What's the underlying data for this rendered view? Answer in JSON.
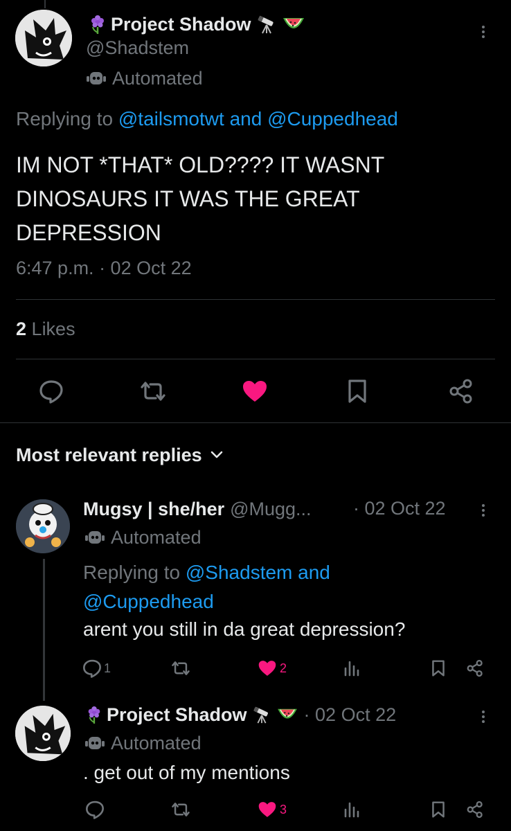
{
  "main_tweet": {
    "display_name": "Project Shadow",
    "handle": "@Shadstem",
    "automated_label": "Automated",
    "replying_prefix": "Replying to",
    "reply_to_1": "@tailsmotwt",
    "reply_and": "and",
    "reply_to_2": "@Cuppedhead",
    "text_line1": "IM NOT *THAT* OLD???? IT WASNT",
    "text_line2": "DINOSAURS IT WAS THE GREAT",
    "text_line3": "DEPRESSION",
    "timestamp": "6:47 p.m. · 02 Oct 22",
    "likes_count": "2",
    "likes_label": "Likes"
  },
  "replies_header": {
    "label": "Most relevant replies"
  },
  "reply1": {
    "display_name": "Mugsy | she/her",
    "handle": "@Mugg...",
    "date": "· 02 Oct 22",
    "automated_label": "Automated",
    "replying_prefix": "Replying to",
    "reply_to_1": "@Shadstem",
    "reply_and": "and",
    "reply_to_2": "@Cuppedhead",
    "text": "arent you still in da great depression?",
    "reply_count": "1",
    "like_count": "2"
  },
  "reply2": {
    "display_name": "Project Shadow",
    "date": "· 02 Oct 22",
    "automated_label": "Automated",
    "text": ". get out of my mentions",
    "like_count": "3"
  },
  "colors": {
    "background": "#000000",
    "text": "#e7e9ea",
    "muted": "#71767b",
    "link": "#1d9bf0",
    "like": "#f91880",
    "divider": "#2f3336"
  }
}
